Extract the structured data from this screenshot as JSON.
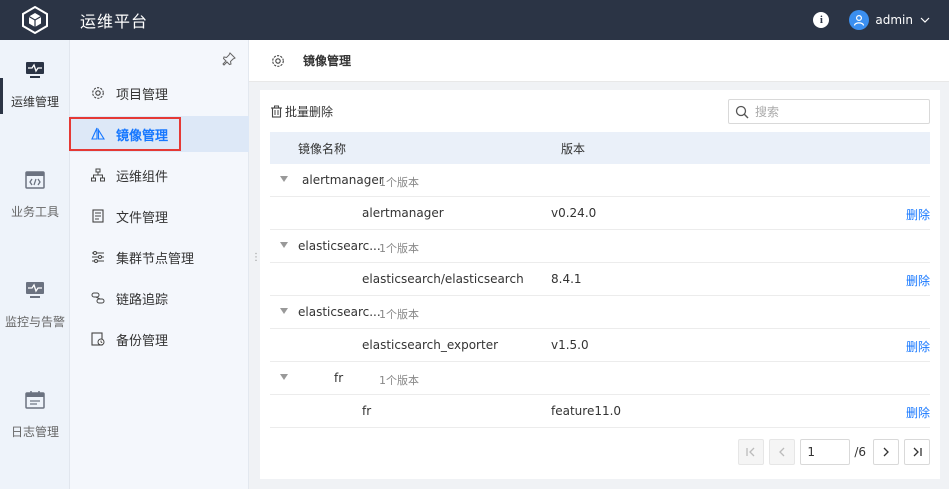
{
  "app": {
    "title": "运维平台"
  },
  "user": {
    "name": "admin"
  },
  "rail": {
    "items": [
      {
        "label": "运维管理",
        "icon": "monitor-pulse-icon",
        "active": true
      },
      {
        "label": "业务工具",
        "icon": "code-window-icon",
        "active": false
      },
      {
        "label": "监控与告警",
        "icon": "monitor-alert-icon",
        "active": false
      },
      {
        "label": "日志管理",
        "icon": "calendar-log-icon",
        "active": false
      }
    ]
  },
  "submenu": {
    "items": [
      {
        "label": "项目管理",
        "icon": "gear-icon"
      },
      {
        "label": "镜像管理",
        "icon": "sail-icon",
        "active": true
      },
      {
        "label": "运维组件",
        "icon": "hierarchy-icon"
      },
      {
        "label": "文件管理",
        "icon": "document-icon"
      },
      {
        "label": "集群节点管理",
        "icon": "sliders-icon"
      },
      {
        "label": "链路追踪",
        "icon": "link-trace-icon"
      },
      {
        "label": "备份管理",
        "icon": "backup-icon"
      }
    ]
  },
  "header": {
    "title": "镜像管理"
  },
  "toolbar": {
    "batch_delete": "批量删除"
  },
  "search": {
    "placeholder": "搜索"
  },
  "table": {
    "columns": {
      "name": "镜像名称",
      "version": "版本"
    },
    "groups": [
      {
        "name": "alertmanager",
        "count": "1个版本",
        "image": "alertmanager",
        "version": "v0.24.0",
        "action": "删除"
      },
      {
        "name": "elasticsearc...",
        "count": "1个版本",
        "image": "elasticsearch/elasticsearch",
        "version": "8.4.1",
        "action": "删除"
      },
      {
        "name": "elasticsearc...",
        "count": "1个版本",
        "image": "elasticsearch_exporter",
        "version": "v1.5.0",
        "action": "删除"
      },
      {
        "name": "fr",
        "count": "1个版本",
        "image": "fr",
        "version": "feature11.0",
        "action": "删除"
      }
    ]
  },
  "pager": {
    "current": "1",
    "total": "/6"
  },
  "colors": {
    "topbar": "#2b3445",
    "accent": "#1677ff",
    "highlight": "#e53935"
  }
}
